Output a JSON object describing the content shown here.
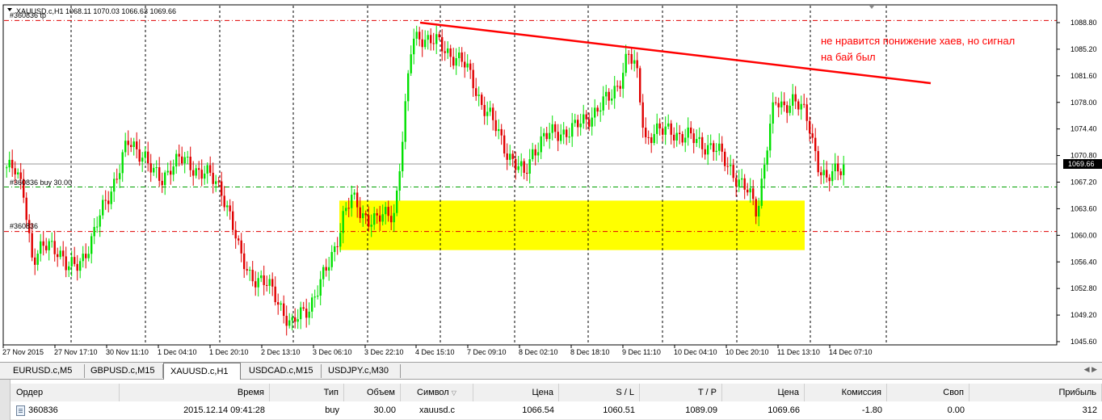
{
  "chart": {
    "info": "XAUUSD.c,H1  1068.11 1070.03 1066.63 1069.66",
    "current_price": "1069.66",
    "annotation_lines": [
      "не нравится понижение хаев, но сигнал",
      "на бай был"
    ],
    "order_labels": {
      "tp": "#360836 tp",
      "buy": "#360836 buy 30.00",
      "sl": "#360836"
    },
    "levels": {
      "tp": 1089.09,
      "entry": 1066.54,
      "sl": 1060.51,
      "bid": 1069.66
    },
    "price_axis": [
      "1088.80",
      "1085.20",
      "1081.60",
      "1078.00",
      "1074.40",
      "1070.80",
      "1067.20",
      "1063.60",
      "1060.00",
      "1056.40",
      "1052.80",
      "1049.20",
      "1045.60"
    ],
    "time_axis": [
      "27 Nov 2015",
      "27 Nov 17:10",
      "30 Nov 11:10",
      "1 Dec 04:10",
      "1 Dec 20:10",
      "2 Dec 13:10",
      "3 Dec 06:10",
      "3 Dec 22:10",
      "4 Dec 15:10",
      "7 Dec 09:10",
      "8 Dec 02:10",
      "8 Dec 18:10",
      "9 Dec 11:10",
      "10 Dec 04:10",
      "10 Dec 20:10",
      "11 Dec 13:10",
      "14 Dec 07:10"
    ],
    "colors": {
      "bull": "#00e000",
      "bear": "#e00000",
      "level": "#e00000",
      "entry": "#00a000",
      "zone": "#ffff00",
      "trendline": "#ff0000"
    },
    "close_path": [
      1069.2,
      1068.5,
      1066.0,
      1056.5,
      1057.8,
      1059.0,
      1058.2,
      1055.4,
      1055.8,
      1057.5,
      1059.6,
      1063.2,
      1066.1,
      1068.8,
      1072.4,
      1071.8,
      1070.9,
      1068.2,
      1067.4,
      1069.6,
      1070.3,
      1069.5,
      1069.0,
      1068.6,
      1067.2,
      1066.0,
      1062.5,
      1057.2,
      1055.0,
      1054.2,
      1053.3,
      1052.2,
      1050.0,
      1047.5,
      1049.2,
      1050.4,
      1052.5,
      1055.0,
      1058.3,
      1062.7,
      1064.9,
      1063.2,
      1062.3,
      1061.9,
      1062.8,
      1063.3,
      1074.5,
      1086.5,
      1087.1,
      1086.4,
      1085.9,
      1085.0,
      1084.2,
      1083.1,
      1081.0,
      1078.0,
      1076.0,
      1073.8,
      1071.4,
      1069.5,
      1068.0,
      1071.5,
      1073.0,
      1073.6,
      1073.9,
      1074.2,
      1074.6,
      1075.5,
      1076.7,
      1077.7,
      1078.6,
      1080.9,
      1084.7,
      1082.1,
      1073.0,
      1074.1,
      1073.9,
      1074.3,
      1073.6,
      1073.2,
      1072.8,
      1072.3,
      1071.7,
      1070.5,
      1069.0,
      1067.0,
      1065.6,
      1063.3,
      1071.5,
      1077.9,
      1077.2,
      1078.8,
      1077.3,
      1074.8,
      1070.0,
      1067.3,
      1068.4,
      1069.66
    ]
  },
  "tabs": [
    {
      "label": "EURUSD.c,M5"
    },
    {
      "label": "GBPUSD.c,M15"
    },
    {
      "label": "XAUUSD.c,H1"
    },
    {
      "label": "USDCAD.c,M15"
    },
    {
      "label": "USDJPY.c,M30"
    }
  ],
  "terminal": {
    "headers": [
      "Ордер",
      "Время",
      "Тип",
      "Объем",
      "Символ",
      "Цена",
      "S / L",
      "T / P",
      "Цена",
      "Комиссия",
      "Своп",
      "Прибыль"
    ],
    "rows": [
      [
        "360836",
        "2015.12.14 09:41:28",
        "buy",
        "30.00",
        "xauusd.c",
        "1066.54",
        "1060.51",
        "1089.09",
        "1069.66",
        "-1.80",
        "0.00",
        "312"
      ]
    ]
  }
}
